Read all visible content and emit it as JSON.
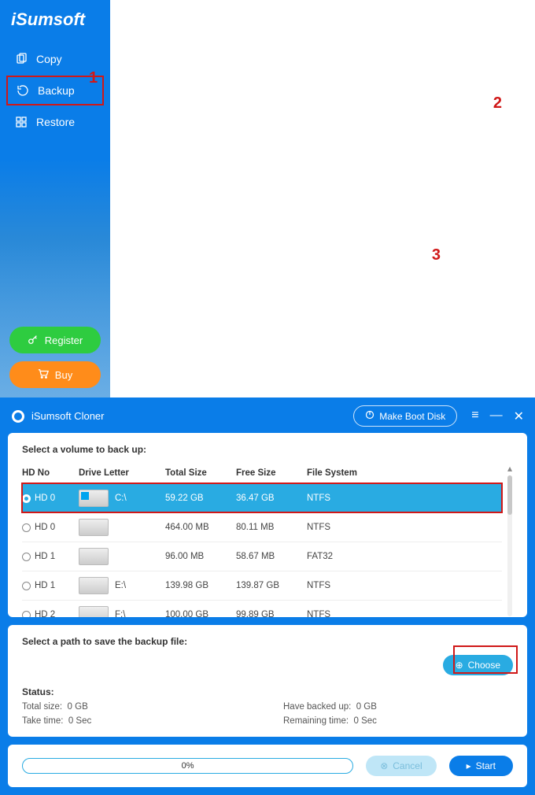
{
  "brand": "iSumsoft",
  "app_title": "iSumsoft Cloner",
  "titlebar": {
    "make_boot": "Make Boot Disk"
  },
  "nav": {
    "copy": "Copy",
    "backup": "Backup",
    "restore": "Restore"
  },
  "sidebar_buttons": {
    "register": "Register",
    "buy": "Buy"
  },
  "volumes": {
    "heading": "Select a volume to back up:",
    "columns": {
      "hd": "HD No",
      "letter": "Drive Letter",
      "total": "Total Size",
      "free": "Free Size",
      "fs": "File System"
    },
    "rows": [
      {
        "hd": "HD 0",
        "letter": "C:\\",
        "total": "59.22 GB",
        "free": "36.47 GB",
        "fs": "NTFS",
        "selected": true,
        "win": true
      },
      {
        "hd": "HD 0",
        "letter": "",
        "total": "464.00 MB",
        "free": "80.11 MB",
        "fs": "NTFS"
      },
      {
        "hd": "HD 1",
        "letter": "",
        "total": "96.00 MB",
        "free": "58.67 MB",
        "fs": "FAT32"
      },
      {
        "hd": "HD 1",
        "letter": "E:\\",
        "total": "139.98 GB",
        "free": "139.87 GB",
        "fs": "NTFS"
      },
      {
        "hd": "HD 2",
        "letter": "F:\\",
        "total": "100.00 GB",
        "free": "99.89 GB",
        "fs": "NTFS"
      }
    ]
  },
  "save": {
    "heading": "Select a path to save the backup file:",
    "choose": "Choose",
    "status_label": "Status:",
    "total_size_label": "Total size:",
    "total_size_value": "0 GB",
    "backed_up_label": "Have backed up:",
    "backed_up_value": "0 GB",
    "take_time_label": "Take time:",
    "take_time_value": "0 Sec",
    "remaining_label": "Remaining time:",
    "remaining_value": "0 Sec"
  },
  "footer": {
    "progress": "0%",
    "cancel": "Cancel",
    "start": "Start"
  },
  "annotations": {
    "a1": "1",
    "a2": "2",
    "a3": "3"
  }
}
